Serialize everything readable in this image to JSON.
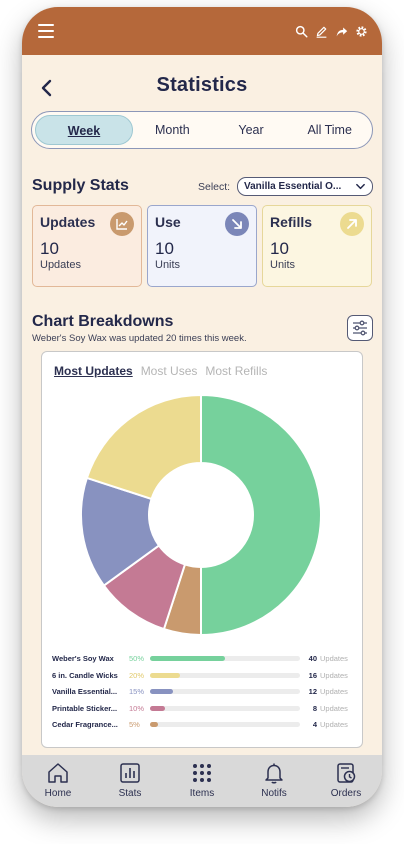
{
  "header": {
    "title": "Statistics"
  },
  "period_tabs": [
    {
      "label": "Week",
      "active": true
    },
    {
      "label": "Month",
      "active": false
    },
    {
      "label": "Year",
      "active": false
    },
    {
      "label": "All Time",
      "active": false
    }
  ],
  "supply": {
    "title": "Supply Stats",
    "select_label": "Select:",
    "selected_item": "Vanilla Essential O...",
    "cards": [
      {
        "title": "Updates",
        "value": "10",
        "unit": "Updates",
        "icon": "trend-chart-icon",
        "color": "#c99a6e"
      },
      {
        "title": "Use",
        "value": "10",
        "unit": "Units",
        "icon": "arrow-down-right-icon",
        "color": "#7b86b8"
      },
      {
        "title": "Refills",
        "value": "10",
        "unit": "Units",
        "icon": "arrow-up-right-icon",
        "color": "#ecdb90"
      }
    ]
  },
  "breakdown": {
    "title": "Chart Breakdowns",
    "subtitle": "Weber's Soy Wax was updated 20 times this week.",
    "tabs": [
      {
        "label": "Most Updates",
        "active": true
      },
      {
        "label": "Most Uses",
        "active": false
      },
      {
        "label": "Most Refills",
        "active": false
      }
    ]
  },
  "chart_data": {
    "type": "pie",
    "donut": true,
    "categories": [
      "Weber's Soy Wax",
      "Cedar Fragrance...",
      "Printable Sticker...",
      "Vanilla Essential...",
      "6 in. Candle Wicks"
    ],
    "values": [
      50,
      5,
      10,
      15,
      20
    ],
    "colors": [
      "#76d19c",
      "#c99a6e",
      "#c47a94",
      "#8892c0",
      "#ecdb90"
    ]
  },
  "legend": [
    {
      "name": "Weber's Soy Wax",
      "pct": "50%",
      "fill": 0.5,
      "count": "40",
      "unit": "Updates",
      "color": "#76d19c"
    },
    {
      "name": "6 in. Candle Wicks",
      "pct": "20%",
      "fill": 0.2,
      "count": "16",
      "unit": "Updates",
      "color": "#ecdb90"
    },
    {
      "name": "Vanilla Essential...",
      "pct": "15%",
      "fill": 0.15,
      "count": "12",
      "unit": "Updates",
      "color": "#8892c0"
    },
    {
      "name": "Printable Sticker...",
      "pct": "10%",
      "fill": 0.1,
      "count": "8",
      "unit": "Updates",
      "color": "#c47a94"
    },
    {
      "name": "Cedar Fragrance...",
      "pct": "5%",
      "fill": 0.05,
      "count": "4",
      "unit": "Updates",
      "color": "#c99a6e"
    }
  ],
  "nav": [
    {
      "label": "Home",
      "icon": "home-icon"
    },
    {
      "label": "Stats",
      "icon": "stats-icon"
    },
    {
      "label": "Items",
      "icon": "grid-dots-icon"
    },
    {
      "label": "Notifs",
      "icon": "bell-icon"
    },
    {
      "label": "Orders",
      "icon": "orders-clock-icon"
    }
  ]
}
